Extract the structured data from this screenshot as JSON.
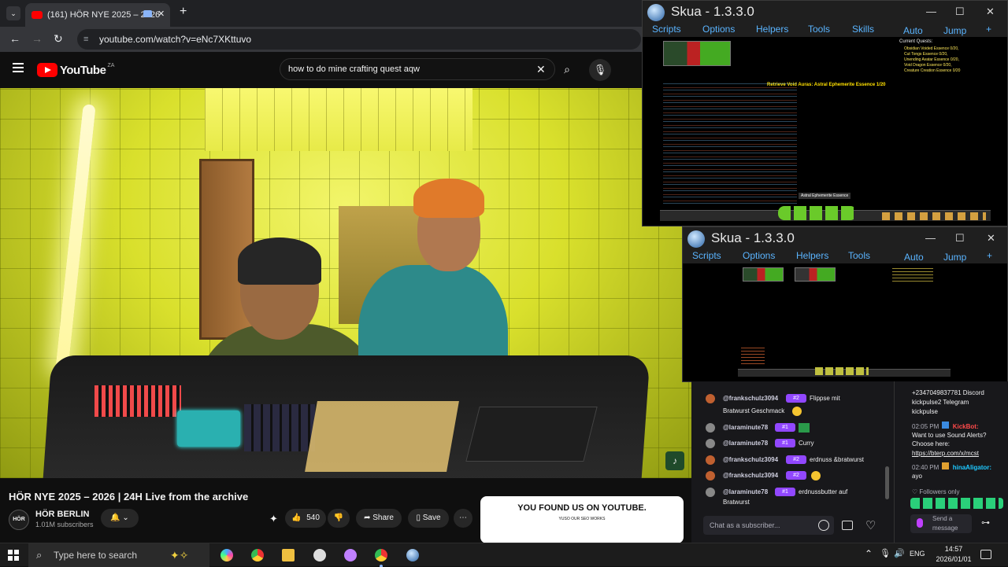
{
  "browser": {
    "tab_title": "(161) HÖR NYE 2025 – 2026",
    "new_tab": "+",
    "close_tab": "✕",
    "url": "youtube.com/watch?v=eNc7XKttuvo"
  },
  "youtube": {
    "logo": "YouTube",
    "region": "ZA",
    "search_query": "how to do mine crafting quest aqw",
    "video_title": "HÖR NYE 2025 – 2026 | 24H Live from the archive",
    "channel_avatar": "HÖR",
    "channel_name": "HÖR BERLIN",
    "subscribers": "1.01M subscribers",
    "likes": "540",
    "share": "Share",
    "save": "Save",
    "promo_title": "YOU FOUND US ON YOUTUBE.",
    "promo_sub": "YUSO OUR SEO WORKS"
  },
  "skua_main": {
    "title": "Skua - 1.3.3.0",
    "menu": [
      "Scripts",
      "Options",
      "Helpers",
      "Tools",
      "Skills"
    ],
    "auto": "Auto",
    "jump": "Jump",
    "add": "+",
    "quests_header": "Current Quests:",
    "quests": [
      "Obsidian Voided Essence 0/20,",
      "Cut Tongs Essence 0/20,",
      "Unending Avatar Essence 0/20,",
      "Void Dragon Essence 0/20,",
      "Creature Creation Essence 0/20"
    ],
    "status": "Retrieve Void Auras: Astral Ephemerite Essence 1/20",
    "tooltip": "Astral Ephemerite Essence"
  },
  "skua_second": {
    "title": "Skua - 1.3.3.0",
    "menu": [
      "Scripts",
      "Options",
      "Helpers",
      "Tools"
    ],
    "auto": "Auto",
    "jump": "Jump",
    "add": "+"
  },
  "chat": {
    "messages": [
      {
        "user": "@frankschulz3094",
        "badge": "#2",
        "text": "Flippse mit"
      },
      {
        "user": "",
        "badge": "",
        "text": "Bratwurst Geschmack"
      },
      {
        "user": "@laraminute78",
        "badge": "#1",
        "text": ""
      },
      {
        "user": "@laraminute78",
        "badge": "#1",
        "text": "Curry"
      },
      {
        "user": "@frankschulz3094",
        "badge": "#2",
        "text": "erdnuss &bratwurst"
      },
      {
        "user": "@frankschulz3094",
        "badge": "#2",
        "text": ""
      },
      {
        "user": "@laraminute78",
        "badge": "#1",
        "text": "erdnussbutter auf"
      },
      {
        "user": "",
        "badge": "",
        "text": "Bratwurst"
      }
    ],
    "input_placeholder": "Chat as a subscriber...",
    "side": {
      "l1": "+2347049837781 Discord",
      "l2": "kickpulse2 Telegram",
      "l3": "kickpulse",
      "t1": "02:05 PM",
      "bot": "KickBot:",
      "b1": "Want to use Sound Alerts?",
      "b2": "Choose here:",
      "link": "https://bterp.com/x/mcst",
      "t2": "02:40 PM",
      "user2": "hinaAligator:",
      "msg2": "ayo",
      "followers": "Followers only",
      "send": "Send a message"
    }
  },
  "taskbar": {
    "search_placeholder": "Type here to search",
    "lang": "ENG",
    "time": "14:57",
    "date": "2026/01/01"
  }
}
